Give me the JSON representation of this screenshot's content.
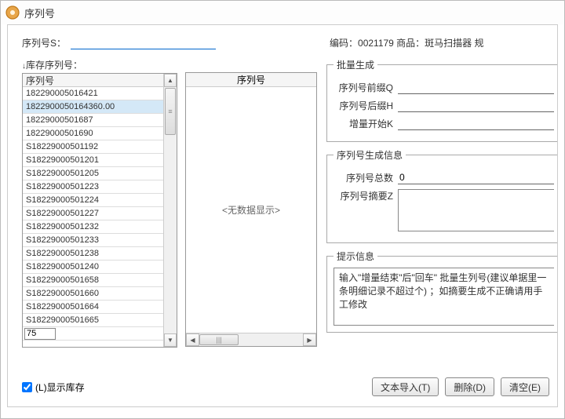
{
  "window": {
    "title": "序列号"
  },
  "top": {
    "serial_label": "序列号S：",
    "serial_value": "",
    "product_info": "编码：0021179  商品：斑马扫描器  规"
  },
  "stock_panel": {
    "header": "库存序列号：",
    "column": "序列号",
    "rows": [
      "182290005016421",
      "1822900050164360.00",
      "18229000501687",
      "18229000501690",
      "S18229000501192",
      "S18229000501201",
      "S18229000501205",
      "S18229000501223",
      "S18229000501224",
      "S18229000501227",
      "S18229000501232",
      "S18229000501233",
      "S18229000501238",
      "S18229000501240",
      "S18229000501658",
      "S18229000501660",
      "S18229000501664",
      "S18229000501665"
    ],
    "selected_index": 1,
    "input_value": "75"
  },
  "serial_list": {
    "header": "序列号",
    "empty_text": "<无数据显示>"
  },
  "batch": {
    "legend": "批量生成",
    "prefix_label": "序列号前缀Q",
    "prefix_value": "",
    "suffix_label": "序列号后缀H",
    "suffix_value": "",
    "start_label": "增量开始K",
    "start_value": ""
  },
  "gen_info": {
    "legend": "序列号生成信息",
    "total_label": "序列号总数",
    "total_value": "0",
    "summary_label": "序列号摘要Z"
  },
  "tips": {
    "legend": "提示信息",
    "text": "输入\"增量结束\"后\"回车\" 批量生列号(建议单据里一条明细记录不超过个)  ；如摘要生成不正确请用手工修改"
  },
  "bottom": {
    "show_stock_label": "(L)显示库存",
    "show_stock_checked": true,
    "import_label": "文本导入(T)",
    "delete_label": "删除(D)",
    "clear_label": "清空(E)"
  }
}
